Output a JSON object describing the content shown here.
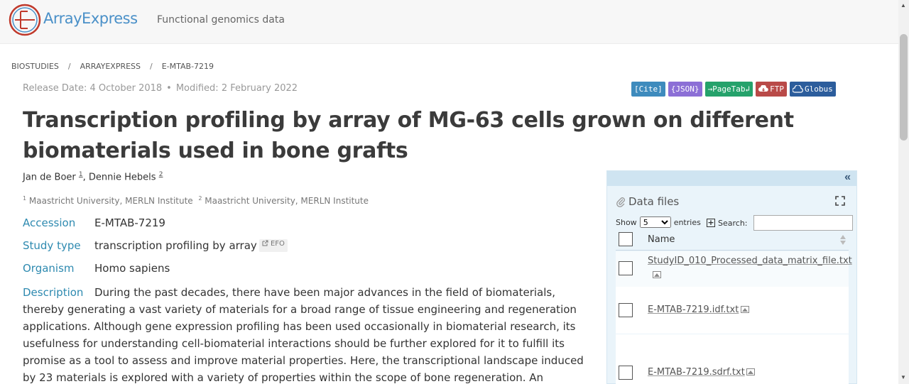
{
  "header": {
    "logo_text": "ArrayExpress",
    "tagline": "Functional genomics data"
  },
  "breadcrumb": {
    "items": [
      "BIOSTUDIES",
      "ARRAYEXPRESS",
      "E-MTAB-7219"
    ],
    "separator": "/"
  },
  "dates": {
    "release": "Release Date: 4 October 2018",
    "separator": "•",
    "modified": "Modified: 2 February 2022"
  },
  "badges": {
    "cite": "[Cite]",
    "json": "{JSON}",
    "pagetab": "→PageTab↲",
    "ftp": "FTP",
    "globus": "Globus"
  },
  "title": "Transcription profiling by array of MG-63 cells grown on different biomaterials used in bone grafts",
  "authors": {
    "a1_name": "Jan de Boer",
    "a1_sup": "1",
    "sep": ", ",
    "a2_name": "Dennie Hebels",
    "a2_sup": "2"
  },
  "affiliations": {
    "a1_sup": "1",
    "a1": "Maastricht University, MERLN Institute",
    "a2_sup": "2",
    "a2": "Maastricht University, MERLN Institute"
  },
  "metadata": {
    "accession_label": "Accession",
    "accession_value": "E-MTAB-7219",
    "study_type_label": "Study type",
    "study_type_value": "transcription profiling by array",
    "study_type_tag": "EFO",
    "organism_label": "Organism",
    "organism_value": "Homo sapiens",
    "description_label": "Description",
    "description_value": "During the past decades, there have been major advances in the field of biomaterials, thereby generating a vast variety of materials for a broad range of tissue engineering and regeneration applications. Although gene expression profiling has been used occasionally in biomaterial research, its usefulness for understanding cell-biomaterial interactions should be further explored for it to fulfill its promise as a tool to assess and improve material properties. Here, the transcriptional landscape induced by 23 materials is explored with a variety of properties within the scope of bone regeneration. An osteoblast cell line is used to identify the"
  },
  "data_files": {
    "collapse_icon": "«",
    "title": "Data files",
    "show_label": "Show",
    "show_value": "5",
    "entries_label": "entries",
    "search_label": "Search:",
    "search_value": "",
    "column_name": "Name",
    "files": [
      "StudyID_010_Processed_data_matrix_file.txt",
      "E-MTAB-7219.idf.txt",
      "E-MTAB-7219.sdrf.txt"
    ]
  },
  "colors": {
    "accent": "#2e8ab0",
    "logo": "#4a90c8",
    "cite": "#3e8bbd",
    "json": "#8c6fd6",
    "pagetab": "#25a26b",
    "ftp": "#b94a48",
    "globus": "#2c5d9c"
  }
}
